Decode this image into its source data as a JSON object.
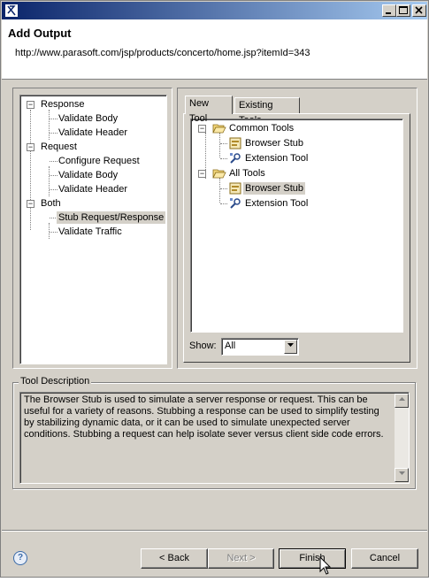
{
  "window": {
    "header_title": "Add Output",
    "header_url": "http://www.parasoft.com/jsp/products/concerto/home.jsp?itemId=343"
  },
  "left_tree": {
    "items": [
      {
        "label": "Response"
      },
      {
        "label": "Validate Body"
      },
      {
        "label": "Validate Header"
      },
      {
        "label": "Request"
      },
      {
        "label": "Configure Request"
      },
      {
        "label": "Validate Body"
      },
      {
        "label": "Validate Header"
      },
      {
        "label": "Both"
      },
      {
        "label": "Stub Request/Response"
      },
      {
        "label": "Validate Traffic"
      }
    ]
  },
  "tabs": [
    {
      "label": "New Tool"
    },
    {
      "label": "Existing Tools"
    }
  ],
  "tool_tree": {
    "items": [
      {
        "label": "Common Tools"
      },
      {
        "label": "Browser Stub"
      },
      {
        "label": "Extension Tool"
      },
      {
        "label": "All Tools"
      },
      {
        "label": "Browser Stub"
      },
      {
        "label": "Extension Tool"
      }
    ]
  },
  "show": {
    "label": "Show:",
    "value": "All"
  },
  "description": {
    "group_label": "Tool Description",
    "text": "The Browser Stub is used to simulate a server response or request.  This can be useful for a variety of reasons.  Stubbing a response can be used to simplify testing by stabilizing dynamic data, or it can be used to simulate unexpected server conditions.  Stubbing a request can help isolate sever versus client side code errors."
  },
  "buttons": {
    "help": "?",
    "back": "< Back",
    "next": "Next >",
    "finish": "Finish",
    "cancel": "Cancel"
  },
  "colors": {
    "face": "#d4d0c8",
    "title_start": "#0a246a",
    "title_end": "#a6caf0"
  }
}
